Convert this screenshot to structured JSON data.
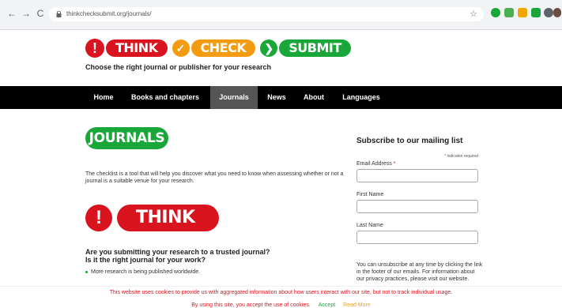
{
  "browser": {
    "url": "thinkchecksubmit.org/journals/",
    "back_icon": "←",
    "forward_icon": "→",
    "reload_icon": "C",
    "star_icon": "☆",
    "ext1": "",
    "ext2": "",
    "ext3": "",
    "ext4": "",
    "ext5": "",
    "ext6": ""
  },
  "header": {
    "logo_alert": "!",
    "logo_think": "THINK",
    "logo_check_icon": "✓",
    "logo_check": "CHECK",
    "logo_next_icon": "❯",
    "logo_submit": "SUBMIT",
    "tagline": "Choose the right journal or publisher for your research"
  },
  "nav": {
    "items": [
      "Home",
      "Books and chapters",
      "Journals",
      "News",
      "About",
      "Languages"
    ],
    "active": "Journals"
  },
  "main": {
    "journals_label": "JOURNALS",
    "intro": "The checklist is a tool that will help you discover what you need to know when assessing whether or not a journal is a suitable venue for your research.",
    "think_alert": "!",
    "think_label": "THINK",
    "question_line1": "Are you submitting your research to a trusted journal?",
    "question_line2": "Is it the right journal for your work?",
    "bullet": "More research is being published worldwide."
  },
  "sidebar": {
    "title": "Subscribe to our mailing list",
    "required_note": "indicates required",
    "required_star": "*",
    "email_label": "Email Address",
    "email_star": "*",
    "first_name_label": "First Name",
    "last_name_label": "Last Name",
    "note": "You can unsubscribe at any time by clicking the link in the footer of our emails. For information about our privacy practices, please visit our website."
  },
  "cookie": {
    "text": "This website uses cookies to provide us with aggregated information about how users interact with our site, but not to track individual usage.",
    "line2": "By using this site, you accept the use of cookies.",
    "accept": "Accept",
    "read_more": "Read More"
  },
  "colors": {
    "red": "#d9141f",
    "orange": "#f39c12",
    "green": "#1aa73a",
    "navbar": "#000000",
    "nav_active": "#555555"
  }
}
